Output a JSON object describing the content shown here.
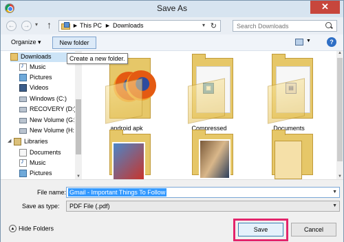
{
  "window": {
    "title": "Save As"
  },
  "nav": {
    "breadcrumbs": [
      "This PC",
      "Downloads"
    ],
    "separator": "►",
    "search_placeholder": "Search Downloads"
  },
  "toolbar": {
    "organize_label": "Organize ▾",
    "new_folder_label": "New folder",
    "tooltip": "Create a new folder."
  },
  "sidebar": {
    "items": [
      {
        "label": "Downloads",
        "icon": "folder-icon",
        "selected": true
      },
      {
        "label": "Music",
        "icon": "music-icon"
      },
      {
        "label": "Pictures",
        "icon": "pictures-icon"
      },
      {
        "label": "Videos",
        "icon": "videos-icon"
      },
      {
        "label": "Windows (C:)",
        "icon": "drive-icon"
      },
      {
        "label": "RECOVERY (D:)",
        "icon": "drive-icon"
      },
      {
        "label": "New Volume (G:)",
        "icon": "drive-icon"
      },
      {
        "label": "New Volume (H:)",
        "icon": "drive-icon"
      },
      {
        "label": "Libraries",
        "icon": "library-icon"
      },
      {
        "label": "Documents",
        "icon": "documents-icon"
      },
      {
        "label": "Music",
        "icon": "music-icon"
      },
      {
        "label": "Pictures",
        "icon": "pictures-icon"
      }
    ]
  },
  "folders": [
    {
      "label": "android apk"
    },
    {
      "label": "Compressed"
    },
    {
      "label": "Documents"
    }
  ],
  "form": {
    "file_name_label": "File name:",
    "file_name_value": "Gmail - Important Things To Follow",
    "save_type_label": "Save as type:",
    "save_type_value": "PDF File (.pdf)"
  },
  "footer": {
    "hide_folders_label": "Hide Folders",
    "save_label": "Save",
    "cancel_label": "Cancel"
  },
  "colors": {
    "highlight_outline": "#e3246b",
    "selection": "#3399ff",
    "close_button": "#c7463c"
  }
}
